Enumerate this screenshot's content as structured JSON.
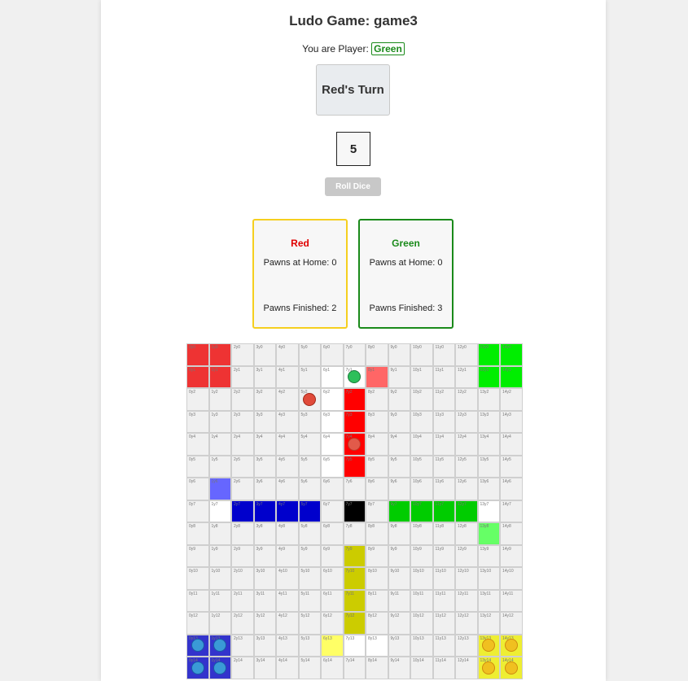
{
  "game": {
    "title": "Ludo Game: game3",
    "player_prefix": "You are Player:",
    "player_color_name": "Green",
    "turn_label": "Red's Turn",
    "dice_value": "5",
    "roll_button_label": "Roll Dice"
  },
  "players": [
    {
      "name": "Red",
      "color": "#e00000",
      "border": "#f5cf1f",
      "home_label": "Pawns at Home: 0",
      "finished_label": "Pawns Finished: 2"
    },
    {
      "name": "Green",
      "color": "#1a8a1a",
      "border": "#1a8a1a",
      "home_label": "Pawns at Home: 0",
      "finished_label": "Pawns Finished: 3"
    }
  ],
  "colors": {
    "red_home": "#ee3333",
    "red_path": "#ff0000",
    "red_light": "#ff6666",
    "green_home": "#00ee00",
    "green_path": "#00cc00",
    "green_light": "#66ff66",
    "blue_home": "#3333cc",
    "blue_path": "#0000cc",
    "blue_light": "#6666ff",
    "yellow_home": "#eeee33",
    "yellow_path": "#cccc00",
    "yellow_light": "#ffff66",
    "center": "#000000",
    "white": "#ffffff",
    "default": "#f0f0f0"
  },
  "board": {
    "size": 15,
    "cell_types": {
      "0,0": "red_home",
      "1,0": "red_home",
      "0,1": "red_home",
      "1,1": "red_home",
      "13,0": "green_home",
      "14,0": "green_home",
      "13,1": "green_home",
      "14,1": "green_home",
      "0,13": "blue_home",
      "1,13": "blue_home",
      "0,14": "blue_home",
      "1,14": "blue_home",
      "13,13": "yellow_home",
      "14,13": "yellow_home",
      "13,14": "yellow_home",
      "14,14": "yellow_home",
      "6,1": "white",
      "7,1": "white",
      "8,1": "red_light",
      "6,2": "white",
      "7,2": "red_path",
      "6,3": "white",
      "7,3": "red_path",
      "6,4": "white",
      "7,4": "red_path",
      "6,5": "white",
      "7,5": "red_path",
      "1,6": "blue_light",
      "1,7": "white",
      "2,7": "blue_path",
      "3,7": "blue_path",
      "4,7": "blue_path",
      "5,7": "blue_path",
      "7,7": "center",
      "9,7": "green_path",
      "10,7": "green_path",
      "11,7": "green_path",
      "12,7": "green_path",
      "13,7": "white",
      "13,8": "green_light",
      "7,9": "yellow_path",
      "7,10": "yellow_path",
      "7,11": "yellow_path",
      "7,12": "yellow_path",
      "6,13": "yellow_light",
      "7,13": "white",
      "8,13": "white"
    },
    "pawns": [
      {
        "cell": "7,1",
        "color": "#2dbf5a",
        "border": "#1a7a3a"
      },
      {
        "cell": "5,2",
        "color": "#e04a3a",
        "border": "#a02a1a"
      },
      {
        "cell": "7,4",
        "color": "#e25a4a",
        "border": "#b83a2a"
      },
      {
        "cell": "0,13",
        "color": "#3a9ad6",
        "border": "#1a5aa6"
      },
      {
        "cell": "1,13",
        "color": "#3a9ad6",
        "border": "#1a5aa6"
      },
      {
        "cell": "0,14",
        "color": "#3a9ad6",
        "border": "#1a5aa6"
      },
      {
        "cell": "1,14",
        "color": "#3a9ad6",
        "border": "#1a5aa6"
      },
      {
        "cell": "13,13",
        "color": "#f0c020",
        "border": "#d08a10"
      },
      {
        "cell": "14,13",
        "color": "#f0c020",
        "border": "#d08a10"
      },
      {
        "cell": "13,14",
        "color": "#f0c020",
        "border": "#d08a10"
      },
      {
        "cell": "14,14",
        "color": "#f0c020",
        "border": "#d08a10"
      }
    ]
  }
}
